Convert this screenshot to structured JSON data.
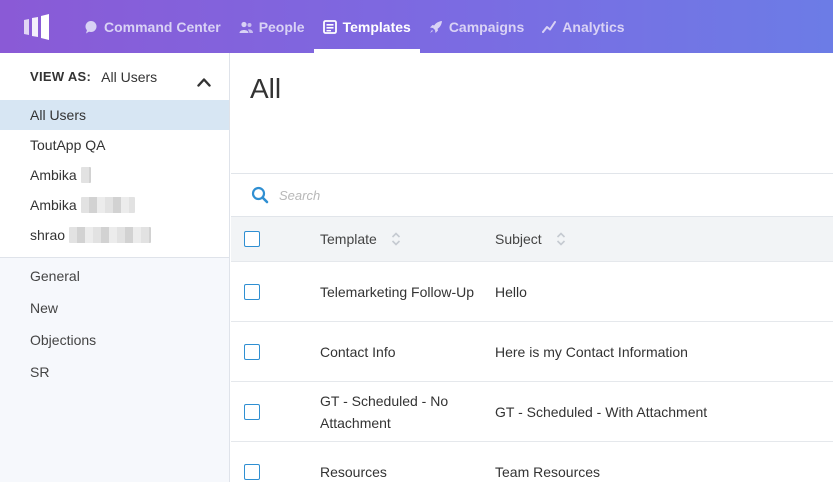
{
  "nav": {
    "items": [
      {
        "label": "Command Center",
        "icon": "chat-bubble-icon",
        "active": false
      },
      {
        "label": "People",
        "icon": "people-icon",
        "active": false
      },
      {
        "label": "Templates",
        "icon": "templates-icon",
        "active": true
      },
      {
        "label": "Campaigns",
        "icon": "rocket-icon",
        "active": false
      },
      {
        "label": "Analytics",
        "icon": "analytics-icon",
        "active": false
      }
    ]
  },
  "sidebar": {
    "view_as_label": "VIEW AS:",
    "view_as_value": "All Users",
    "users": [
      {
        "label": "All Users",
        "active": true
      },
      {
        "label": "ToutApp QA"
      },
      {
        "label": "Ambika"
      },
      {
        "label": "Ambika"
      },
      {
        "label": "shrao"
      }
    ],
    "folders": [
      {
        "label": "General"
      },
      {
        "label": "New"
      },
      {
        "label": "Objections"
      },
      {
        "label": "SR"
      }
    ]
  },
  "main": {
    "title": "All",
    "search_placeholder": "Search",
    "columns": {
      "template": "Template",
      "subject": "Subject"
    },
    "rows": [
      {
        "template": "Telemarketing Follow-Up",
        "subject": "Hello"
      },
      {
        "template": "Contact Info",
        "subject": "Here is my Contact Information"
      },
      {
        "template": "GT - Scheduled - No Attachment",
        "subject": "GT - Scheduled - With Attachment"
      },
      {
        "template": "Resources",
        "subject": "Team Resources"
      }
    ]
  },
  "colors": {
    "accent": "#2f8fd2",
    "nav_start": "#8a5ad6",
    "nav_end": "#6c7ce6"
  }
}
